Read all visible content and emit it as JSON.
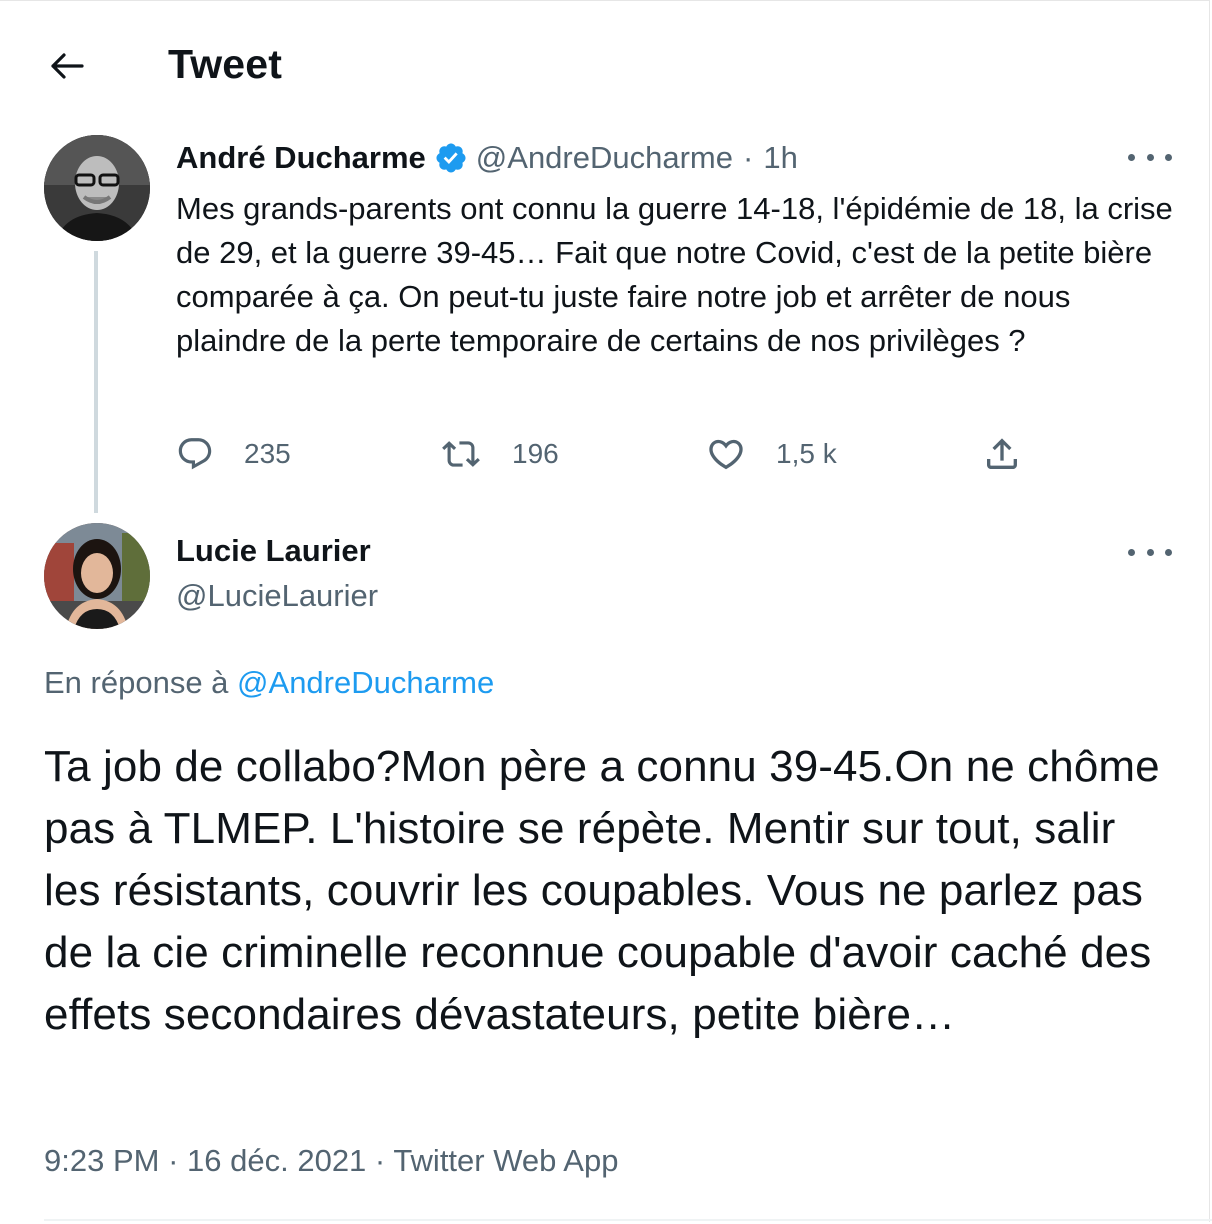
{
  "header": {
    "title": "Tweet",
    "back_icon": "arrow-left-icon"
  },
  "tweet": {
    "author": {
      "name": "André Ducharme",
      "handle": "@AndreDucharme",
      "verified": true,
      "avatar": "andre-avatar"
    },
    "separator": "·",
    "time": "1h",
    "text": "Mes grands-parents ont connu la guerre 14-18, l'épidémie de 18, la crise de 29, et la guerre 39-45… Fait que notre Covid, c'est de la petite bière comparée à ça. On peut-tu juste faire notre job et arrêter de nous plaindre de la perte temporaire de certains de nos privilèges ?",
    "stats": {
      "replies": "235",
      "retweets": "196",
      "likes": "1,5 k"
    }
  },
  "reply": {
    "author": {
      "name": "Lucie Laurier",
      "handle": "@LucieLaurier",
      "avatar": "lucie-avatar"
    },
    "in_reply_label": "En réponse à",
    "in_reply_mention": "@AndreDucharme",
    "text": "Ta job de collabo?Mon père a connu 39-45.On ne chôme pas à TLMEP. L'histoire se répète. Mentir sur tout, salir les résistants, couvrir les coupables. Vous ne parlez pas de la cie criminelle reconnue coupable d'avoir caché des effets secondaires dévastateurs, petite bière…",
    "time": "9:23 PM",
    "date": "16 déc. 2021",
    "source": "Twitter Web App",
    "meta_separator": "·"
  },
  "colors": {
    "text": "#0f1419",
    "secondary": "#536471",
    "accent": "#1d9bf0",
    "thread_line": "#cfd9de"
  }
}
